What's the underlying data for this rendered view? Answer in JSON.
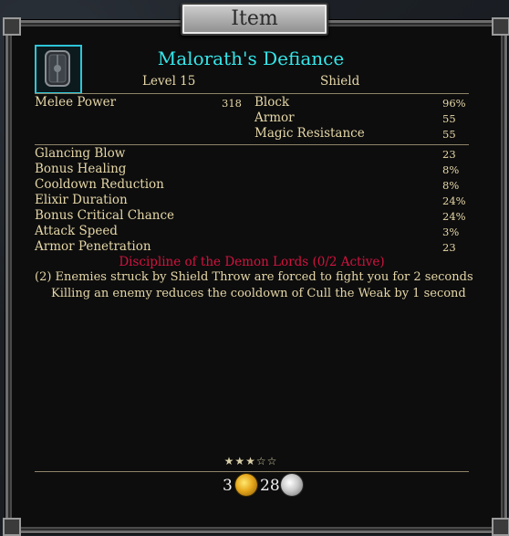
{
  "window": {
    "title": "Item"
  },
  "item": {
    "name": "Malorath's Defiance",
    "level_label": "Level 15",
    "type": "Shield",
    "icon": "shield-icon",
    "name_color": "#35e6ea"
  },
  "primary_stats": {
    "left": [
      {
        "label": "Melee Power",
        "value": "318"
      }
    ],
    "right": [
      {
        "label": "Block",
        "value": "96%"
      },
      {
        "label": "Armor",
        "value": "55"
      },
      {
        "label": "Magic Resistance",
        "value": "55"
      }
    ]
  },
  "secondary_stats": [
    {
      "label": "Glancing Blow",
      "value": "23"
    },
    {
      "label": "Bonus Healing",
      "value": "8%"
    },
    {
      "label": "Cooldown Reduction",
      "value": "8%"
    },
    {
      "label": "Elixir Duration",
      "value": "24%"
    },
    {
      "label": "Bonus Critical Chance",
      "value": "24%"
    },
    {
      "label": "Attack Speed",
      "value": "3%"
    },
    {
      "label": "Armor Penetration",
      "value": "23"
    }
  ],
  "set": {
    "name": "Discipline of the Demon Lords (0/2 Active)",
    "color": "#d2133f",
    "bonus_line1": "(2) Enemies struck by Shield Throw are forced to fight you for 2 seconds",
    "bonus_line2": "Killing an enemy reduces the cooldown of Cull the Weak by 1 second"
  },
  "rating": {
    "stars": "★★★☆☆",
    "filled": 3,
    "total": 5
  },
  "price": {
    "gold": "3",
    "silver": "28",
    "gold_icon": "gold-coin-icon",
    "silver_icon": "silver-coin-icon"
  }
}
